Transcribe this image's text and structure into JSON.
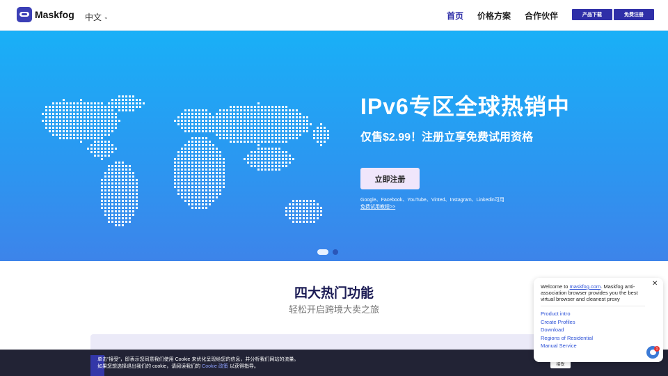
{
  "header": {
    "logo_text": "Maskfog",
    "language": "中文",
    "nav": [
      {
        "label": "首页",
        "active": true
      },
      {
        "label": "价格方案",
        "active": false
      },
      {
        "label": "合作伙伴",
        "active": false
      }
    ],
    "download_button": "产品下载",
    "register_button": "免费注册"
  },
  "hero": {
    "title": "IPv6专区全球热销中",
    "subtitle": "仅售$2.99！注册立享免费试用资格",
    "cta": "立即注册",
    "note": "Google、Facebook、YouTube、Vinted、Instagram、Linkedin可用",
    "tutorial_link": "免费试用教程>>",
    "carousel": {
      "slides": 2,
      "active": 1
    }
  },
  "features": {
    "title": "四大热门功能",
    "subtitle": "轻松开启跨境大卖之旅"
  },
  "cookie": {
    "line1": "单击“接受”，即表示您同意我们使用 Cookie 来优化呈现给您的信息，并分析我们网站的流量。",
    "line2_prefix": "如果您想选择退出我们的 cookie，请阅读我们的",
    "policy_link": "Cookie 政策",
    "line2_suffix": "以获得指导。",
    "accept": "接受"
  },
  "chat": {
    "welcome_prefix": "Welcome to ",
    "welcome_link": "maskfog.com",
    "welcome_suffix": ". Maskfog anti-association browser provides you the best virtual browser and cleanest proxy",
    "links": [
      "Product intro",
      "Create Profiles",
      "Download",
      "Regions of Residential",
      "Manual Service"
    ],
    "badge_count": "1"
  },
  "colors": {
    "brand": "#2f2fa8",
    "hero_top": "#19b0f7",
    "hero_bottom": "#3d84ea",
    "cookie_bg": "#222335"
  }
}
